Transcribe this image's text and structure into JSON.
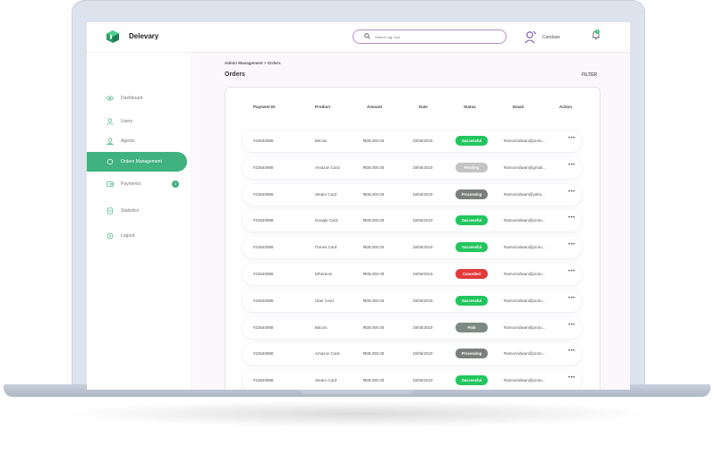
{
  "brand": {
    "name": "Delevary"
  },
  "search": {
    "placeholder": "Search log. text"
  },
  "user": {
    "name": "Candase"
  },
  "notifications": {
    "count": "3"
  },
  "sidebar": {
    "items": [
      {
        "label": "Dashboard",
        "icon": "eye-icon"
      },
      {
        "label": "Users",
        "icon": "user-icon"
      },
      {
        "label": "Agents",
        "icon": "agent-icon"
      },
      {
        "label": "Orders Management",
        "icon": "orders-icon",
        "active": true
      },
      {
        "label": "Payments",
        "icon": "wallet-icon",
        "badge": "2"
      },
      {
        "label": "Statistics",
        "icon": "stats-icon"
      },
      {
        "label": "Logout",
        "icon": "logout-icon"
      }
    ]
  },
  "main": {
    "breadcrumb": "Admin Management > Orders",
    "title": "Orders",
    "filter_label": "FILTER"
  },
  "table": {
    "columns": [
      "Payment ID",
      "Product",
      "Amount",
      "Date",
      "Status",
      "Email",
      "Action"
    ],
    "rows": [
      {
        "id": "#23640988",
        "product": "Bitcoin",
        "amount": "₦39,000.00",
        "date": "19/06/2019",
        "status": "Successful",
        "email": "Ramonridwan@proto..."
      },
      {
        "id": "#23640988",
        "product": "Amazon Card",
        "amount": "₦39,000.00",
        "date": "19/06/2019",
        "status": "Pending",
        "email": "Ramonridwan@gmail..."
      },
      {
        "id": "#23640988",
        "product": "Steam Card",
        "amount": "₦39,000.00",
        "date": "19/06/2019",
        "status": "Processing",
        "email": "Ramonridwan@yaho..."
      },
      {
        "id": "#23640988",
        "product": "Google Card",
        "amount": "₦39,000.00",
        "date": "19/06/2019",
        "status": "Successful",
        "email": "Ramonridwan@proto..."
      },
      {
        "id": "#23640988",
        "product": "iTunes Card",
        "amount": "₦39,000.00",
        "date": "19/06/2019",
        "status": "Successful",
        "email": "Ramonridwan@proto..."
      },
      {
        "id": "#23640988",
        "product": "Ethereum",
        "amount": "₦39,000.00",
        "date": "19/06/2019",
        "status": "Cancelled",
        "email": "Ramonridwan@proto..."
      },
      {
        "id": "#23640988",
        "product": "Uber Card",
        "amount": "₦39,000.00",
        "date": "19/06/2019",
        "status": "Successful",
        "email": "Ramonridwan@proto..."
      },
      {
        "id": "#23640988",
        "product": "Bitcoin",
        "amount": "₦39,000.00",
        "date": "19/06/2019",
        "status": "Paid",
        "email": "Ramonridwan@proto..."
      },
      {
        "id": "#23640988",
        "product": "Amazon Card",
        "amount": "₦39,000.00",
        "date": "19/06/2019",
        "status": "Processing",
        "email": "Ramonridwan@proto..."
      },
      {
        "id": "#23640988",
        "product": "Steam Card",
        "amount": "₦39,000.00",
        "date": "19/06/2019",
        "status": "Successful",
        "email": "Ramonridwan@proto..."
      }
    ],
    "action_label": "•••"
  },
  "status_colors": {
    "Successful": "#22c55e",
    "Pending": "#c4c4c4",
    "Processing": "#7a7f7c",
    "Cancelled": "#e23b3b",
    "Paid": "#7d8a84"
  },
  "colors": {
    "accent": "#3fb27f",
    "search_border": "#b48fc9"
  }
}
